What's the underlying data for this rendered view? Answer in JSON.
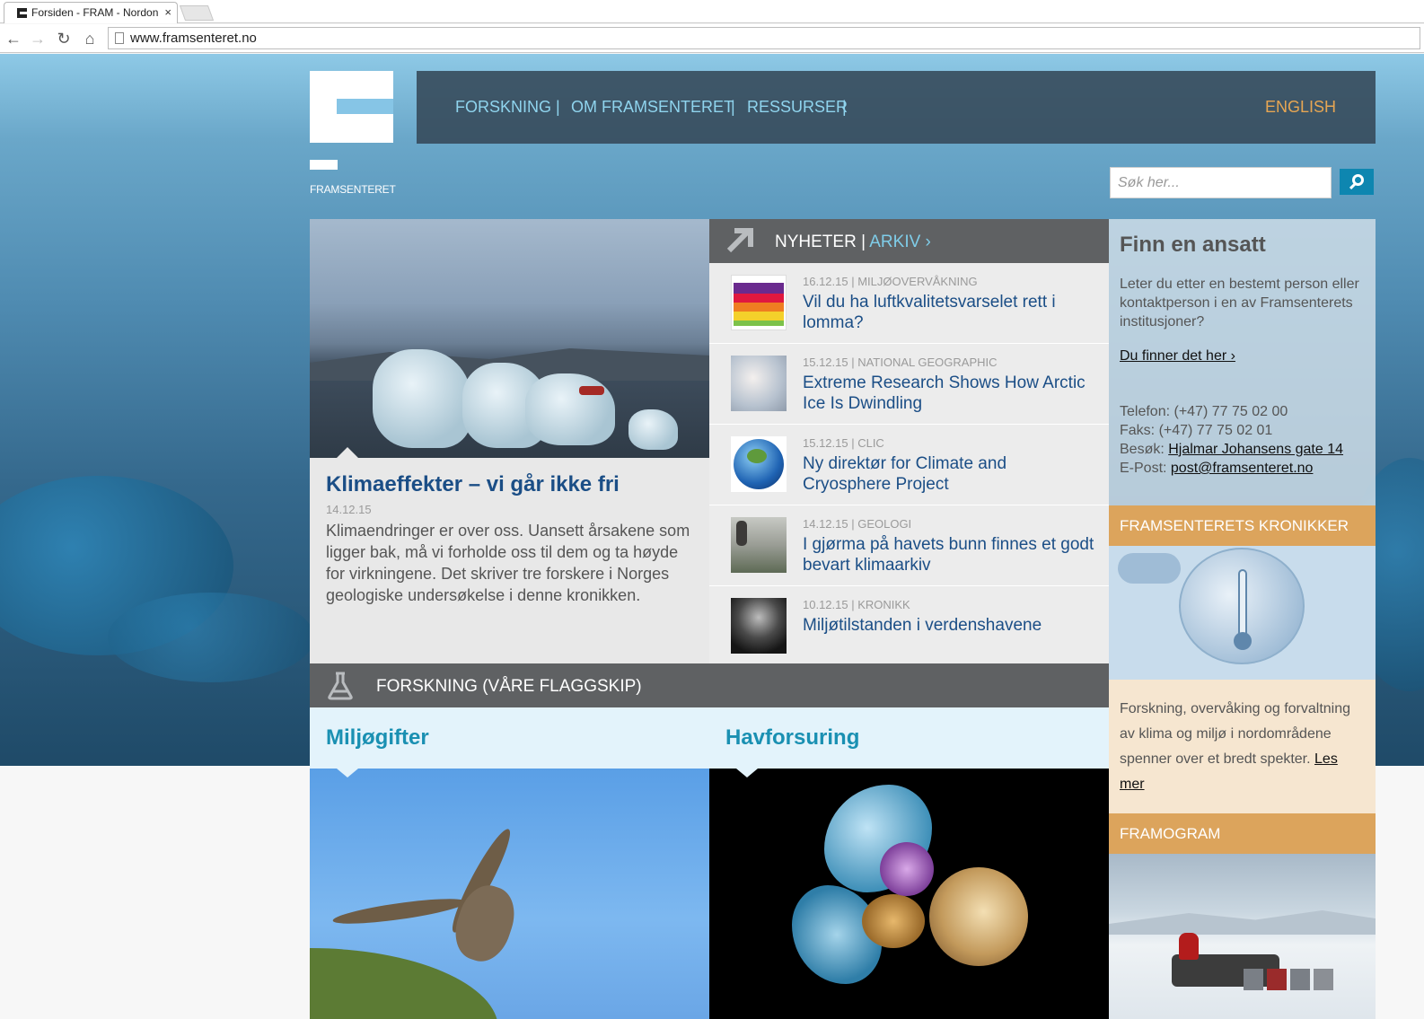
{
  "browser": {
    "tab_title": "Forsiden - FRAM - Nordon",
    "tab_close": "×",
    "url": "www.framsenteret.no",
    "back": "←",
    "forward": "→",
    "reload": "↻",
    "home": "⌂"
  },
  "header": {
    "logo_text": "FRAMSENTERET",
    "nav": [
      "FORSKNING",
      "OM FRAMSENTERET",
      "RESSURSER"
    ],
    "separator": "|",
    "language": "ENGLISH",
    "search_placeholder": "Søk her..."
  },
  "feature": {
    "title": "Klimaeffekter – vi går ikke fri",
    "date": "14.12.15",
    "text": "Klimaendringer er over oss. Uansett årsakene som ligger bak, må vi forholde oss til dem og ta høyde for virkningene. Det skriver tre forskere i Norges geologiske undersøkelse i denne kronikken."
  },
  "news": {
    "heading": "NYHETER",
    "heading_sep": " | ",
    "archive": "ARKIV ›",
    "items": [
      {
        "meta": "16.12.15 | MILJØOVERVÅKNING",
        "title": "Vil du ha luftkvalitetsvarselet rett i lomma?",
        "thumb": "air-quality-chart"
      },
      {
        "meta": "15.12.15 | NATIONAL GEOGRAPHIC",
        "title": "Extreme Research Shows How Arctic Ice Is Dwindling",
        "thumb": "arctic-fog"
      },
      {
        "meta": "15.12.15 | CLIC",
        "title": "Ny direktør for Climate and Cryosphere Project",
        "thumb": "earth-globe"
      },
      {
        "meta": "14.12.15 | GEOLOGI",
        "title": "I gjørma på havets bunn finnes et godt bevart klimaarkiv",
        "thumb": "sediment-cores"
      },
      {
        "meta": "10.12.15 | KRONIKK",
        "title": "Miljøtilstanden i verdenshavene",
        "thumb": "diver"
      }
    ]
  },
  "finn": {
    "title": "Finn en ansatt",
    "text": "Leter du etter en bestemt person eller kontaktperson i en av Framsenterets institusjoner?",
    "link": "Du finner det her ›",
    "phone": "Telefon: (+47) 77 75 02 00",
    "fax": "Faks: (+47) 77 75 02 01",
    "visit_label": "Besøk: ",
    "visit_value": "Hjalmar Johansens gate 14",
    "email_label": "E-Post: ",
    "email_value": "post@framsenteret.no"
  },
  "kronikker": {
    "title": "FRAMSENTERETS KRONIKKER",
    "text": "Forskning, overvåking og forvaltning av klima og miljø i nordområdene spenner over et bredt spekter. ",
    "link": "Les mer"
  },
  "framogram": {
    "title": "FRAMOGRAM"
  },
  "research": {
    "heading": "FORSKNING (VÅRE FLAGGSKIP)",
    "cards": [
      {
        "title": "Miljøgifter"
      },
      {
        "title": "Havforsuring"
      }
    ]
  }
}
